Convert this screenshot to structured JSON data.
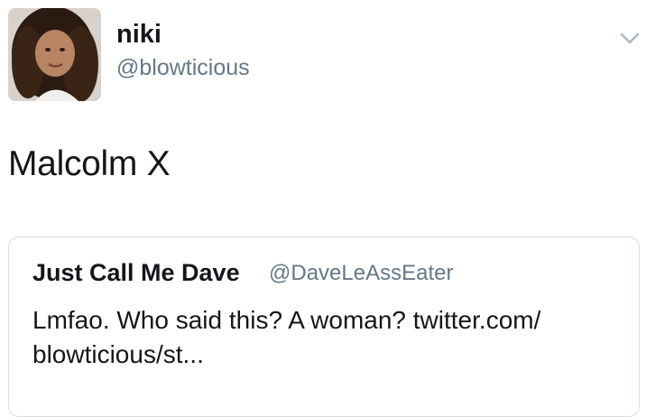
{
  "author": {
    "display_name": "niki",
    "handle": "@blowticious"
  },
  "icons": {
    "avatar": "profile-photo",
    "menu": "chevron-down-icon"
  },
  "tweet": {
    "text": "Malcolm X"
  },
  "quoted_tweet": {
    "display_name": "Just Call Me Dave",
    "handle": "@DaveLeAssEater",
    "text_line1": "Lmfao. Who said this? A woman? twitter.com/",
    "text_line2": "blowticious/st..."
  },
  "colors": {
    "text_primary": "#14171a",
    "text_secondary": "#657786",
    "border": "#d6dce1"
  }
}
